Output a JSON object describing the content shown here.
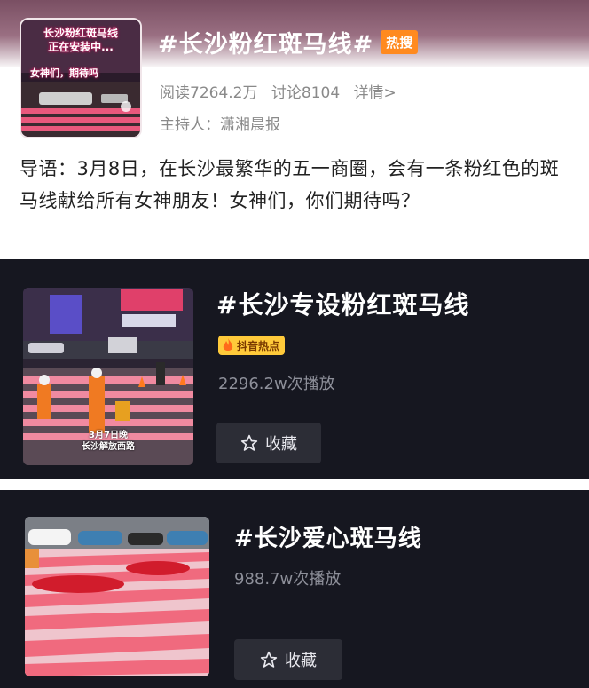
{
  "weibo_topic": {
    "thumbnail": {
      "line1": "长沙粉红斑马线",
      "line2": "正在安装中...",
      "line3": "女神们，期待吗"
    },
    "title": "#长沙粉红斑马线#",
    "hot_badge": "热搜",
    "reads": "阅读7264.2万",
    "discussions": "讨论8104",
    "details_link": "详情>",
    "host": "主持人：潇湘晨报",
    "intro": "导语：3月8日，在长沙最繁华的五一商圈，会有一条粉红色的斑马线献给所有女神朋友！女神们，你们期待吗？"
  },
  "douyin_cards": [
    {
      "title": "#长沙专设粉红斑马线",
      "badge": "抖音热点",
      "plays": "2296.2w次播放",
      "favorite_label": "收藏",
      "thumbnail_caption_1": "3月7日晚",
      "thumbnail_caption_2": "长沙解放西路"
    },
    {
      "title": "#长沙爱心斑马线",
      "plays": "988.7w次播放",
      "favorite_label": "收藏"
    }
  ],
  "colors": {
    "hot_badge": "#ff8a1f",
    "douyin_badge": "#ffca3a",
    "dark_bg": "#161720",
    "crosswalk_pink": "#f06a7e"
  },
  "icons": [
    "star-icon",
    "flame-icon"
  ]
}
